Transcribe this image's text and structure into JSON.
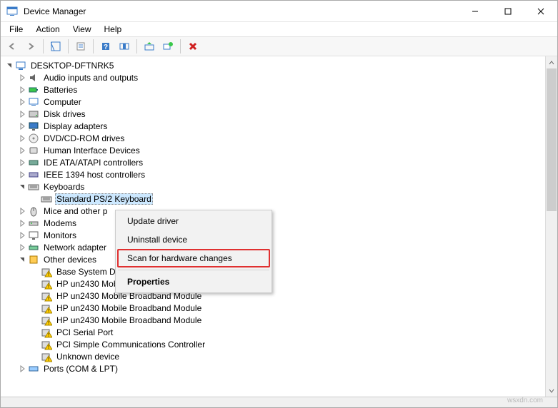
{
  "window": {
    "title": "Device Manager"
  },
  "menubar": [
    "File",
    "Action",
    "View",
    "Help"
  ],
  "toolbar": [
    {
      "name": "back-icon"
    },
    {
      "name": "forward-icon"
    },
    {
      "div": true
    },
    {
      "name": "show-hide-tree-icon"
    },
    {
      "div": true
    },
    {
      "name": "properties-icon"
    },
    {
      "div": true
    },
    {
      "name": "help-icon"
    },
    {
      "name": "print-icon"
    },
    {
      "div": true
    },
    {
      "name": "update-driver-icon"
    },
    {
      "name": "uninstall-icon"
    },
    {
      "div": true
    },
    {
      "name": "delete-icon"
    }
  ],
  "tree": {
    "root": {
      "label": "DESKTOP-DFTNRK5",
      "expanded": true
    },
    "categories": [
      {
        "label": "Audio inputs and outputs",
        "icon": "audio",
        "state": "collapsed"
      },
      {
        "label": "Batteries",
        "icon": "battery",
        "state": "collapsed"
      },
      {
        "label": "Computer",
        "icon": "computer",
        "state": "collapsed"
      },
      {
        "label": "Disk drives",
        "icon": "disk",
        "state": "collapsed"
      },
      {
        "label": "Display adapters",
        "icon": "display",
        "state": "collapsed"
      },
      {
        "label": "DVD/CD-ROM drives",
        "icon": "dvd",
        "state": "collapsed"
      },
      {
        "label": "Human Interface Devices",
        "icon": "hid",
        "state": "collapsed"
      },
      {
        "label": "IDE ATA/ATAPI controllers",
        "icon": "ide",
        "state": "collapsed"
      },
      {
        "label": "IEEE 1394 host controllers",
        "icon": "ieee",
        "state": "collapsed"
      },
      {
        "label": "Keyboards",
        "icon": "keyboard",
        "state": "expanded",
        "children": [
          {
            "label": "Standard PS/2 Keyboard",
            "icon": "keyboard",
            "selected": true
          }
        ]
      },
      {
        "label": "Mice and other p",
        "icon": "mouse",
        "state": "collapsed",
        "truncated": true
      },
      {
        "label": "Modems",
        "icon": "modem",
        "state": "collapsed"
      },
      {
        "label": "Monitors",
        "icon": "monitor",
        "state": "collapsed"
      },
      {
        "label": "Network adapter",
        "icon": "network",
        "state": "collapsed",
        "truncated": true
      },
      {
        "label": "Other devices",
        "icon": "other",
        "state": "expanded",
        "children": [
          {
            "label": "Base System Dev",
            "icon": "warn",
            "truncated": true
          },
          {
            "label": "HP un2430 Mobile Broadband Module",
            "icon": "warn"
          },
          {
            "label": "HP un2430 Mobile Broadband Module",
            "icon": "warn"
          },
          {
            "label": "HP un2430 Mobile Broadband Module",
            "icon": "warn"
          },
          {
            "label": "HP un2430 Mobile Broadband Module",
            "icon": "warn"
          },
          {
            "label": "PCI Serial Port",
            "icon": "warn"
          },
          {
            "label": "PCI Simple Communications Controller",
            "icon": "warn"
          },
          {
            "label": "Unknown device",
            "icon": "warn"
          }
        ]
      },
      {
        "label": "Ports (COM & LPT)",
        "icon": "port",
        "state": "collapsed"
      }
    ]
  },
  "context_menu": {
    "items": [
      {
        "label": "Update driver"
      },
      {
        "label": "Uninstall device"
      },
      {
        "label": "Scan for hardware changes",
        "highlight": true
      },
      {
        "div": true
      },
      {
        "label": "Properties",
        "bold": true
      }
    ]
  },
  "branding": "wsxdn.com"
}
